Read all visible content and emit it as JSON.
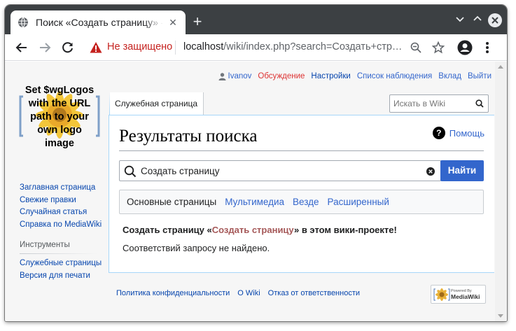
{
  "browser": {
    "tab_title": "Поиск «Создать страницу» — MyWiki",
    "security_label": "Не защищено",
    "url_host": "localhost",
    "url_path": "/wiki/index.php?search=Создать+стр…",
    "icons": [
      "globe-icon",
      "close-icon",
      "plus-icon",
      "back-icon",
      "forward-icon",
      "reload-icon",
      "warning-icon",
      "zoom-icon",
      "star-icon",
      "profile-icon",
      "menu-icon"
    ]
  },
  "personal": {
    "user": "Ivanov",
    "talk": "Обсуждение",
    "preferences": "Настройки",
    "watchlist": "Список наблюдения",
    "contributions": "Вклад",
    "logout": "Выйти"
  },
  "logo": {
    "lines": [
      "Set $wgLogos",
      "with the URL",
      "path to your",
      "own logo",
      "image"
    ]
  },
  "sidebar": {
    "navigation": [
      "Заглавная страница",
      "Свежие правки",
      "Случайная статья",
      "Справка по MediaWiki"
    ],
    "tools_title": "Инструменты",
    "tools": [
      "Служебные страницы",
      "Версия для печати"
    ]
  },
  "tabs": {
    "special": "Служебная страница"
  },
  "header_search": {
    "placeholder": "Искать в Wiki"
  },
  "content": {
    "title": "Результаты поиска",
    "help": "Помощь",
    "search_value": "Создать страницу",
    "go_button": "Найти",
    "profiles": [
      "Основные страницы",
      "Мультимедиа",
      "Везде",
      "Расширенный"
    ],
    "create_prefix": "Создать страницу «",
    "create_link": "Создать страницу",
    "create_suffix": "» в этом вики-проекте!",
    "no_results": "Соответствий запросу не найдено."
  },
  "footer": {
    "links": [
      "Политика конфиденциальности",
      "О Wiki",
      "Отказ от ответственности"
    ],
    "powered_small": "Powered By",
    "powered_big": "MediaWiki"
  },
  "colors": {
    "link": "#0645ad",
    "link_alt": "#36c",
    "redlink": "#a55858",
    "button": "#36c",
    "insecure": "#c5221f",
    "tabstrip": "#3c4043"
  }
}
